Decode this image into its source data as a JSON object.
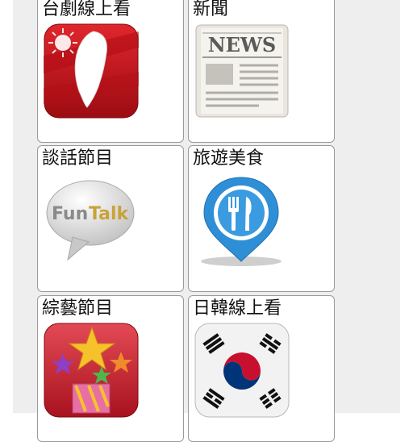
{
  "categories": [
    {
      "label": "台劇線上看",
      "icon": "taiwan-map-icon"
    },
    {
      "label": "新聞",
      "icon": "newspaper-icon"
    },
    {
      "label": "談話節目",
      "icon": "funtalk-bubble-icon"
    },
    {
      "label": "旅遊美食",
      "icon": "food-location-pin-icon"
    },
    {
      "label": "綜藝節目",
      "icon": "party-stars-icon"
    },
    {
      "label": "日韓線上看",
      "icon": "korea-flag-icon"
    }
  ],
  "icon_text": {
    "news": "NEWS",
    "funtalk_fun": "Fun",
    "funtalk_talk": "Talk"
  },
  "colors": {
    "panel_background": "#eeeeee",
    "tile_border": "#9a9a9a",
    "taiwan_red": "#c8101a",
    "pin_blue": "#2f8fd6",
    "korea_red": "#c8102e",
    "korea_blue": "#003478"
  }
}
